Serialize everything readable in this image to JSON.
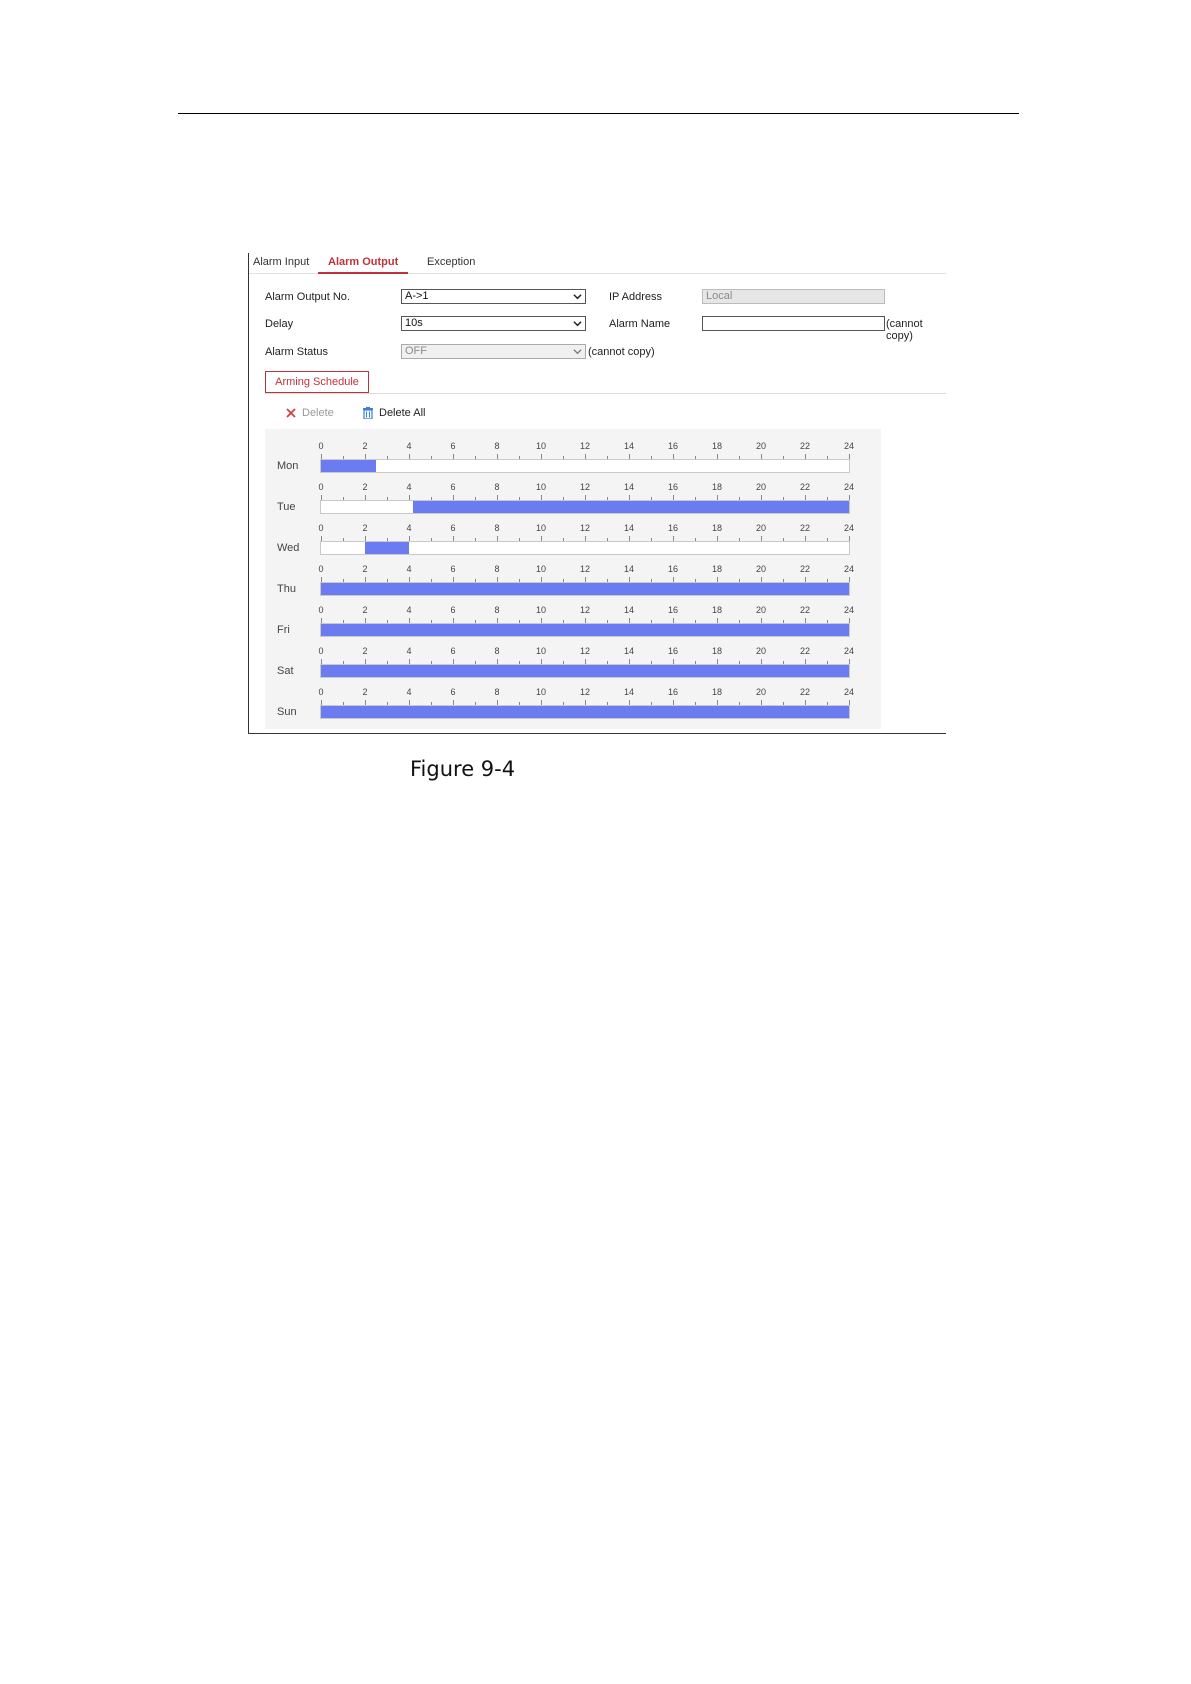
{
  "tabs": [
    {
      "label": "Alarm Input",
      "active": false
    },
    {
      "label": "Alarm Output",
      "active": true
    },
    {
      "label": "Exception",
      "active": false
    }
  ],
  "form": {
    "alarm_output_no": {
      "label": "Alarm Output No.",
      "value": "A->1"
    },
    "delay": {
      "label": "Delay",
      "value": "10s"
    },
    "alarm_status": {
      "label": "Alarm Status",
      "value": "OFF",
      "note": "(cannot copy)"
    },
    "ip_address": {
      "label": "IP Address",
      "value": "Local"
    },
    "alarm_name": {
      "label": "Alarm Name",
      "value": "",
      "note": "(cannot copy)"
    }
  },
  "arming_schedule": {
    "tab_label": "Arming Schedule",
    "delete_label": "Delete",
    "delete_all_label": "Delete All",
    "hour_ticks": [
      "0",
      "2",
      "4",
      "6",
      "8",
      "10",
      "12",
      "14",
      "16",
      "18",
      "20",
      "22",
      "24"
    ],
    "hours_total": 24,
    "days": [
      {
        "label": "Mon",
        "segments": [
          [
            0,
            2.5
          ]
        ]
      },
      {
        "label": "Tue",
        "segments": [
          [
            4.2,
            24
          ]
        ]
      },
      {
        "label": "Wed",
        "segments": [
          [
            2,
            4
          ]
        ]
      },
      {
        "label": "Thu",
        "segments": [
          [
            0,
            24
          ]
        ]
      },
      {
        "label": "Fri",
        "segments": [
          [
            0,
            24
          ]
        ]
      },
      {
        "label": "Sat",
        "segments": [
          [
            0,
            24
          ]
        ]
      },
      {
        "label": "Sun",
        "segments": [
          [
            0,
            24
          ]
        ]
      }
    ]
  },
  "colors": {
    "accent": "#c0323a",
    "schedule_fill": "#6b7cf0"
  },
  "caption": "Figure 9-4"
}
